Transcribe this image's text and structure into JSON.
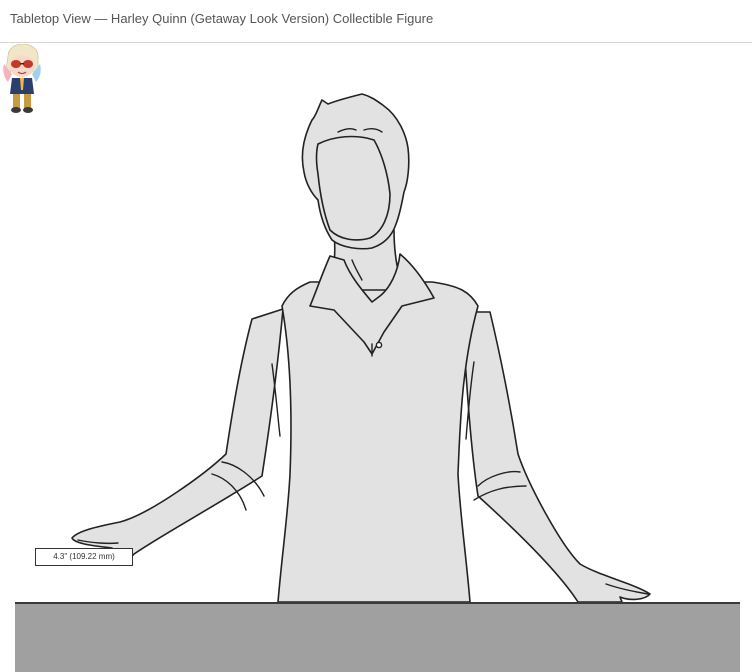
{
  "header": {
    "title": "Tabletop View — Harley Quinn (Getaway Look Version) Collectible Figure"
  },
  "scale": {
    "dimension_label": "4.3\" (109.22 mm)"
  },
  "icons": {
    "person": "person-silhouette-icon",
    "figure": "harley-quinn-figure-icon"
  },
  "colors": {
    "table": "#a0a0a0",
    "silhouette_fill": "#e2e2e2",
    "outline": "#222222"
  }
}
